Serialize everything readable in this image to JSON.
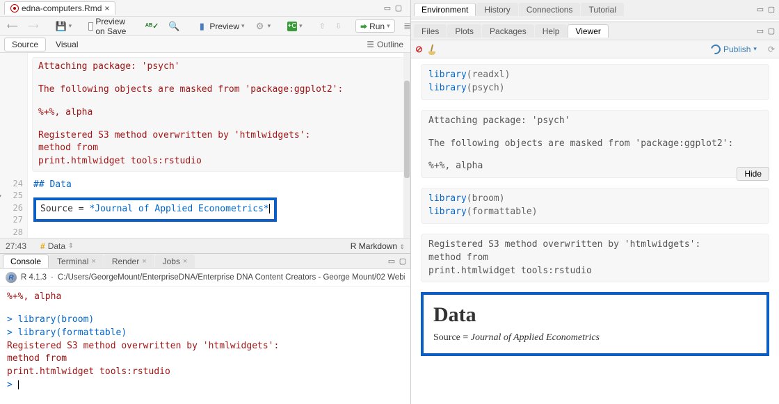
{
  "source_pane": {
    "file_tab": "edna-computers.Rmd",
    "toolbar": {
      "preview_on_save": "Preview on Save",
      "preview_btn": "Preview",
      "run_btn": "Run"
    },
    "view_tabs": {
      "source": "Source",
      "visual": "Visual",
      "outline": "Outline"
    },
    "code": {
      "attach": "Attaching package: 'psych'",
      "masked": "The following objects are masked from 'package:ggplot2':",
      "masked_items": "    %+%, alpha",
      "s3": "Registered S3 method overwritten by 'htmlwidgets':",
      "s3_l2": "  method           from",
      "s3_l3": "  print.htmlwidget tools:rstudio",
      "gutter": [
        "24",
        "25",
        "26",
        "27",
        "28"
      ],
      "heading": "## Data",
      "src_line_prefix": "Source = ",
      "src_line_emph": "*Journal of Applied Econometrics*"
    },
    "status": {
      "pos": "27:43",
      "section": "Data",
      "lang": "R Markdown"
    }
  },
  "console_pane": {
    "tabs": {
      "console": "Console",
      "terminal": "Terminal",
      "render": "Render",
      "jobs": "Jobs"
    },
    "info": {
      "version": "R 4.1.3",
      "path": "C:/Users/GeorgeMount/EnterpriseDNA/Enterprise DNA Content Creators - George Mount/02 Webi"
    },
    "lines": {
      "alpha": "    %+%, alpha",
      "p1": "> ",
      "c1": "library(broom)",
      "p2": "> ",
      "c2": "library(formattable)",
      "s3": "Registered S3 method overwritten by 'htmlwidgets':",
      "s3_l2": "  method           from",
      "s3_l3": "  print.htmlwidget tools:rstudio",
      "prompt": "> "
    }
  },
  "env_pane": {
    "tabs": {
      "env": "Environment",
      "hist": "History",
      "conn": "Connections",
      "tut": "Tutorial"
    }
  },
  "viewer_pane": {
    "tabs": {
      "files": "Files",
      "plots": "Plots",
      "packages": "Packages",
      "help": "Help",
      "viewer": "Viewer"
    },
    "publish": "Publish",
    "hide": "Hide",
    "blocks": {
      "lib1_a": "library",
      "lib1_b": "(readxl)",
      "lib2_a": "library",
      "lib2_b": "(psych)",
      "attach": "Attaching package: 'psych'",
      "masked": "The following objects are masked from 'package:ggplot2':",
      "masked_items": "    %+%, alpha",
      "lib3_a": "library",
      "lib3_b": "(broom)",
      "lib4_a": "library",
      "lib4_b": "(formattable)",
      "s3": "Registered S3 method overwritten by 'htmlwidgets':",
      "s3_l2": "  method           from",
      "s3_l3": "  print.htmlwidget tools:rstudio"
    },
    "output": {
      "heading": "Data",
      "p_prefix": "Source = ",
      "p_emph": "Journal of Applied Econometrics"
    }
  }
}
